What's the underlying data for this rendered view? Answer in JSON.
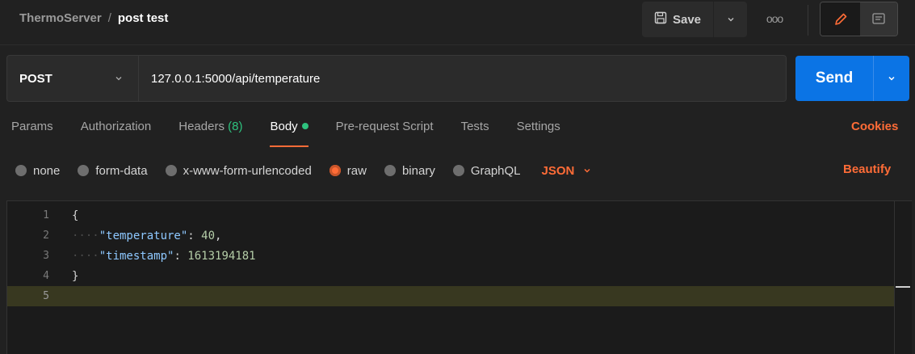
{
  "breadcrumb": {
    "parent": "ThermoServer",
    "separator": "/",
    "current": "post test"
  },
  "toolbar": {
    "save_label": "Save",
    "more_label": "ooo"
  },
  "request": {
    "method": "POST",
    "url": "127.0.0.1:5000/api/temperature",
    "send_label": "Send"
  },
  "tabs": [
    {
      "label": "Params"
    },
    {
      "label": "Authorization"
    },
    {
      "label": "Headers",
      "count": "(8)"
    },
    {
      "label": "Body"
    },
    {
      "label": "Pre-request Script"
    },
    {
      "label": "Tests"
    },
    {
      "label": "Settings"
    }
  ],
  "cookies_label": "Cookies",
  "body_types": [
    {
      "label": "none"
    },
    {
      "label": "form-data"
    },
    {
      "label": "x-www-form-urlencoded"
    },
    {
      "label": "raw"
    },
    {
      "label": "binary"
    },
    {
      "label": "GraphQL"
    }
  ],
  "selected_body_type": "raw",
  "format_label": "JSON",
  "beautify_label": "Beautify",
  "editor": {
    "line_numbers": [
      "1",
      "2",
      "3",
      "4",
      "5"
    ],
    "open_brace": "{",
    "close_brace": "}",
    "key1": "\"temperature\"",
    "colon1": ": ",
    "value1": "40",
    "comma1": ",",
    "key2": "\"timestamp\"",
    "colon2": ": ",
    "value2": "1613194181",
    "indent": "····"
  },
  "colors": {
    "accent": "#ff6c37",
    "send": "#0b74e5",
    "success": "#2ec27e"
  }
}
